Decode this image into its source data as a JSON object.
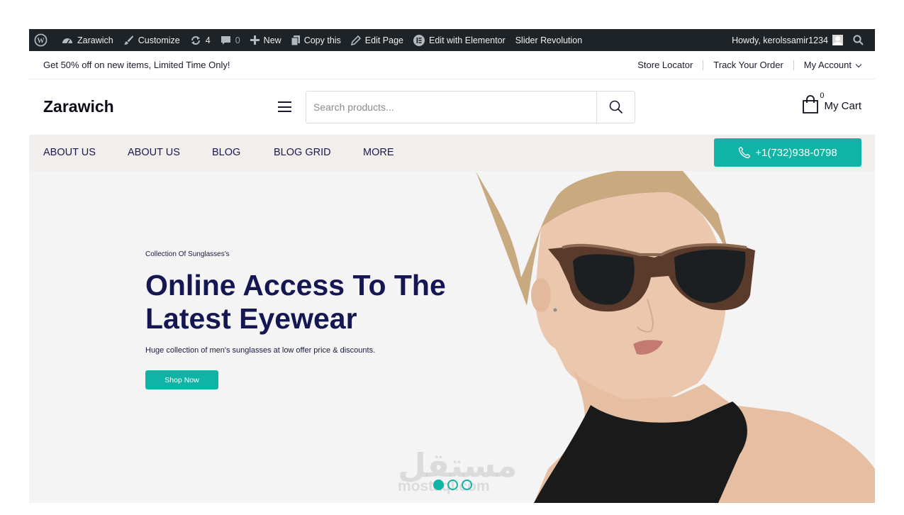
{
  "admin_bar": {
    "items": [
      {
        "icon": "wordpress-logo-icon"
      },
      {
        "icon": "dashboard-icon",
        "label": "Zarawich"
      },
      {
        "icon": "paintbrush-icon",
        "label": "Customize"
      },
      {
        "icon": "updates-icon",
        "label": "4"
      },
      {
        "icon": "comment-icon",
        "label": "0"
      },
      {
        "icon": "plus-icon",
        "label": "New"
      },
      {
        "icon": "copy-icon",
        "label": "Copy this"
      },
      {
        "icon": "pencil-icon",
        "label": "Edit Page"
      },
      {
        "icon": "elementor-icon",
        "label": "Edit with Elementor"
      },
      {
        "label": "Slider Revolution"
      }
    ],
    "greeting": "Howdy, kerolssamir1234",
    "colors": {
      "background": "#1d2327",
      "text": "#f0f0f1"
    }
  },
  "topbar": {
    "promo": "Get 50% off on new items, Limited Time Only!",
    "links": [
      "Store Locator",
      "Track Your Order",
      "My Account"
    ]
  },
  "header": {
    "logo": "Zarawich",
    "search": {
      "placeholder": "Search products..."
    },
    "cart": {
      "count": "0",
      "label": "My Cart"
    }
  },
  "nav": {
    "items": [
      "ABOUT US",
      "ABOUT US",
      "BLOG",
      "BLOG GRID",
      "MORE"
    ],
    "phone": "+1(732)938-0798",
    "colors": {
      "background": "#f1eeec",
      "accent": "#10b3a5",
      "text": "#1a1a4e"
    }
  },
  "hero": {
    "kicker": "Collection Of Sunglasses's",
    "title_line1": "Online Access To The",
    "title_line2": "Latest Eyewear",
    "subtitle": "Huge collection of men's sunglasses at low offer price & discounts.",
    "button": "Shop Now",
    "slides": {
      "count": 3,
      "active": 1
    },
    "watermark": {
      "arabic": "مستقل",
      "latin": "mostaql.com"
    },
    "colors": {
      "title": "#141752",
      "accent": "#10b3a5",
      "background": "#f4f4f4"
    }
  }
}
